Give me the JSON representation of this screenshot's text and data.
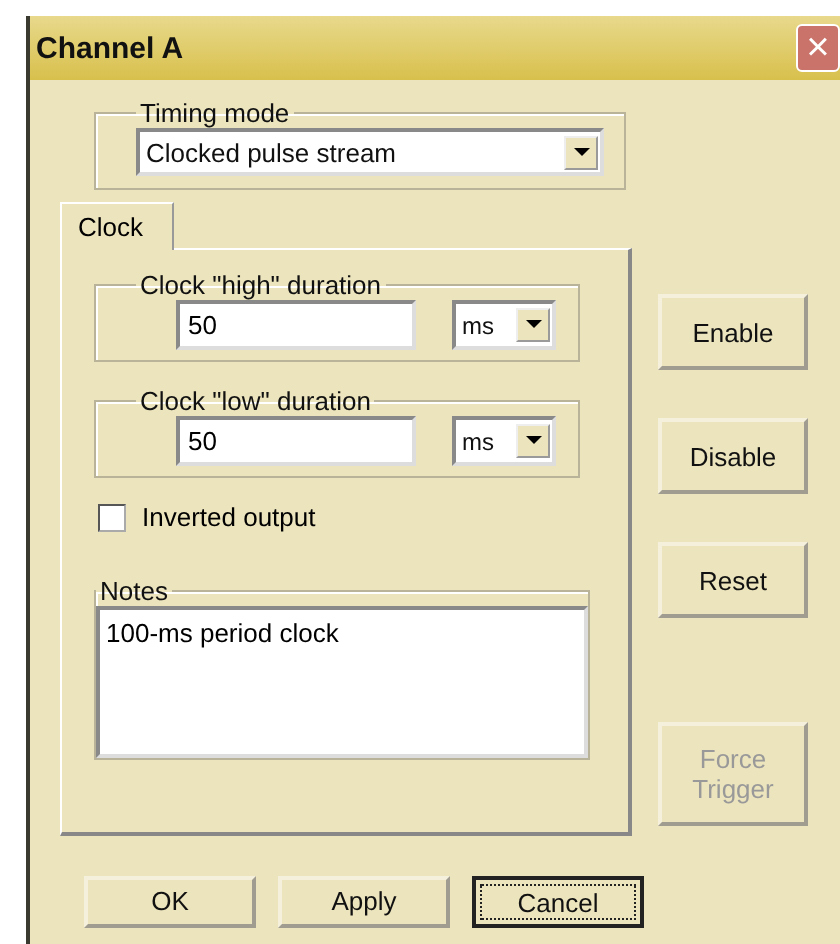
{
  "window": {
    "title": "Channel A",
    "close": "×"
  },
  "timing_mode": {
    "label": "Timing mode",
    "value": "Clocked pulse stream"
  },
  "tabs": [
    {
      "label": "Clock",
      "selected": true
    }
  ],
  "durations": [
    {
      "label": "Clock \"high\" duration",
      "value": "50",
      "unit": "ms"
    },
    {
      "label": "Clock \"low\" duration",
      "value": "50",
      "unit": "ms"
    }
  ],
  "inverted_output": {
    "label": "Inverted output",
    "checked": false
  },
  "notes": {
    "label": "Notes",
    "value": "100-ms period clock"
  },
  "side_buttons": [
    {
      "label": "Enable",
      "disabled": false
    },
    {
      "label": "Disable",
      "disabled": false
    },
    {
      "label": "Reset",
      "disabled": false
    },
    {
      "label": "Force Trigger",
      "disabled": true
    }
  ],
  "buttons": [
    {
      "label": "OK",
      "focused": false
    },
    {
      "label": "Apply",
      "focused": false
    },
    {
      "label": "Cancel",
      "focused": true
    }
  ]
}
